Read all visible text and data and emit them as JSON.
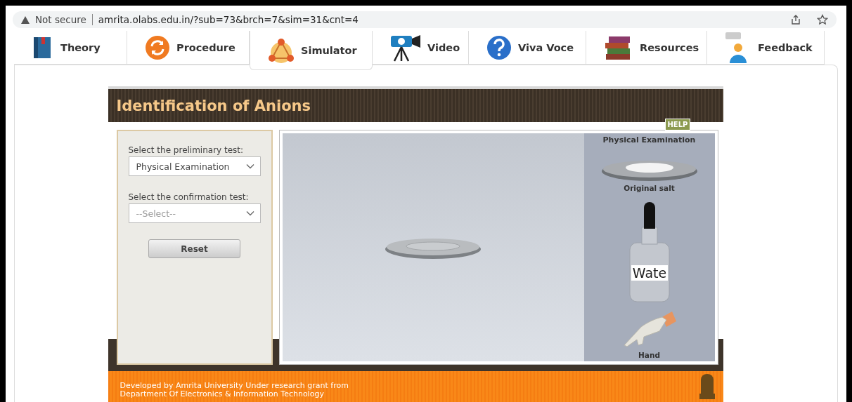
{
  "browser": {
    "security": "Not secure",
    "url": "amrita.olabs.edu.in/?sub=73&brch=7&sim=31&cnt=4"
  },
  "tabs": [
    {
      "label": "Theory",
      "kind": "book",
      "selected": false
    },
    {
      "label": "Procedure",
      "kind": "refresh",
      "selected": false
    },
    {
      "label": "Simulator",
      "kind": "simulator",
      "selected": true
    },
    {
      "label": "Video",
      "kind": "camera",
      "selected": false
    },
    {
      "label": "Viva Voce",
      "kind": "question",
      "selected": false
    },
    {
      "label": "Resources",
      "kind": "books",
      "selected": false
    },
    {
      "label": "Feedback",
      "kind": "feedback",
      "selected": false
    }
  ],
  "simulator": {
    "title": "Identification of Anions",
    "help": "HELP",
    "selects": [
      {
        "label": "Select the preliminary test:",
        "value": "Physical Examination"
      },
      {
        "label": "Select the confirmation test:",
        "placeholder": "--Select--"
      }
    ],
    "reset": "Reset",
    "tray": {
      "title": "Physical Examination",
      "items": [
        {
          "kind": "salt",
          "label": "Original salt"
        },
        {
          "kind": "bottle",
          "bottle_label": "Wate"
        },
        {
          "kind": "hand",
          "label": "Hand"
        }
      ]
    }
  },
  "footer": [
    "Developed by Amrita University Under research grant from",
    "Department Of Electronics & Information Technology"
  ]
}
